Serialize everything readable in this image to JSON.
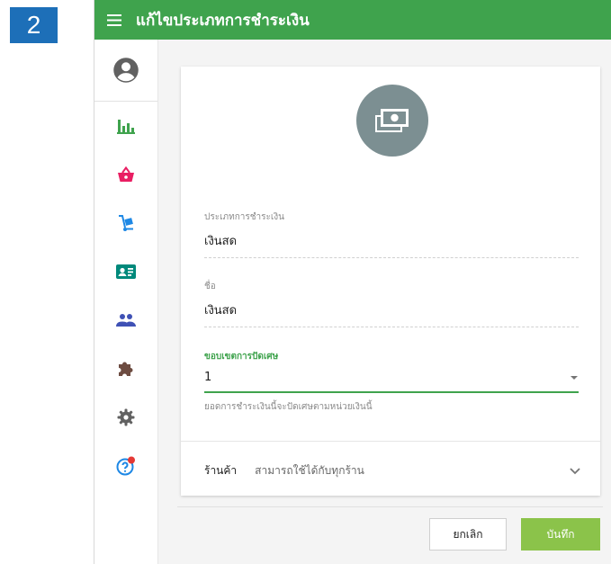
{
  "step_number": "2",
  "topbar": {
    "title": "แก้ไขประเภทการชำระเงิน"
  },
  "sidebar": {
    "items": [
      {
        "icon": "account-circle-icon",
        "color": "#616161"
      },
      {
        "icon": "bar-chart-icon",
        "color": "#3fa34d"
      },
      {
        "icon": "basket-icon",
        "color": "#e91e63"
      },
      {
        "icon": "hand-truck-icon",
        "color": "#1e88e5"
      },
      {
        "icon": "contact-card-icon",
        "color": "#00897b"
      },
      {
        "icon": "people-icon",
        "color": "#3f51b5"
      },
      {
        "icon": "puzzle-icon",
        "color": "#6d4c41"
      },
      {
        "icon": "gear-icon",
        "color": "#616161"
      },
      {
        "icon": "help-icon",
        "color": "#1e88e5"
      }
    ]
  },
  "form": {
    "payment_type": {
      "label": "ประเภทการชำระเงิน",
      "value": "เงินสด"
    },
    "name": {
      "label": "ชื่อ",
      "value": "เงินสด"
    },
    "rounding": {
      "label": "ขอบเขตการปัดเศษ",
      "value": "1",
      "hint": "ยอดการชำระเงินนี้จะปัดเศษตามหน่วยเงินนี้"
    },
    "store": {
      "label": "ร้านค้า",
      "value": "สามารถใช้ได้กับทุกร้าน"
    }
  },
  "actions": {
    "cancel_label": "ยกเลิก",
    "save_label": "บันทึก"
  },
  "colors": {
    "topbar": "#3fa34d",
    "save_button": "#8bc34a",
    "step_badge": "#1d6fb8",
    "avatar": "#7c8f92"
  }
}
